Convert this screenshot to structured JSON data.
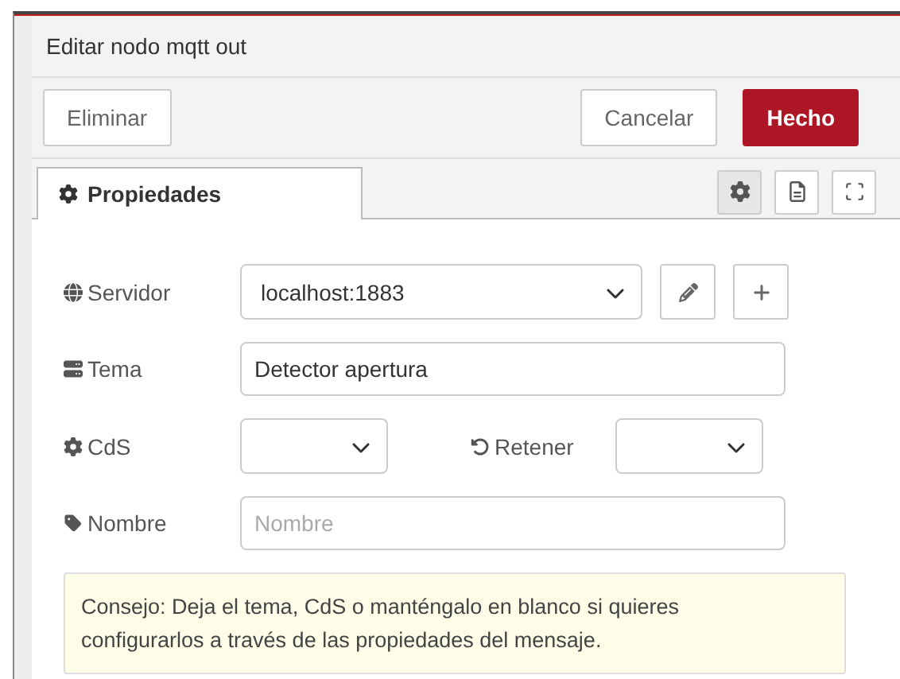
{
  "dialog": {
    "title": "Editar nodo mqtt out"
  },
  "buttons": {
    "delete": "Eliminar",
    "cancel": "Cancelar",
    "done": "Hecho"
  },
  "tabs": [
    {
      "label": "Propiedades",
      "selected": true
    }
  ],
  "tab_tools": [
    {
      "kind": "settings",
      "selected": true
    },
    {
      "kind": "description",
      "selected": false
    },
    {
      "kind": "appearance",
      "selected": false
    }
  ],
  "fields": {
    "server": {
      "label": "Servidor",
      "value": "localhost:1883"
    },
    "topic": {
      "label": "Tema",
      "value": "Detector apertura"
    },
    "qos": {
      "label": "CdS"
    },
    "retain": {
      "label": "Retener"
    },
    "name": {
      "label": "Nombre",
      "placeholder": "Nombre"
    }
  },
  "tip": "Consejo: Deja el tema, CdS o manténgalo en blanco si quieres configurarlos a través de las propiedades del mensaje."
}
